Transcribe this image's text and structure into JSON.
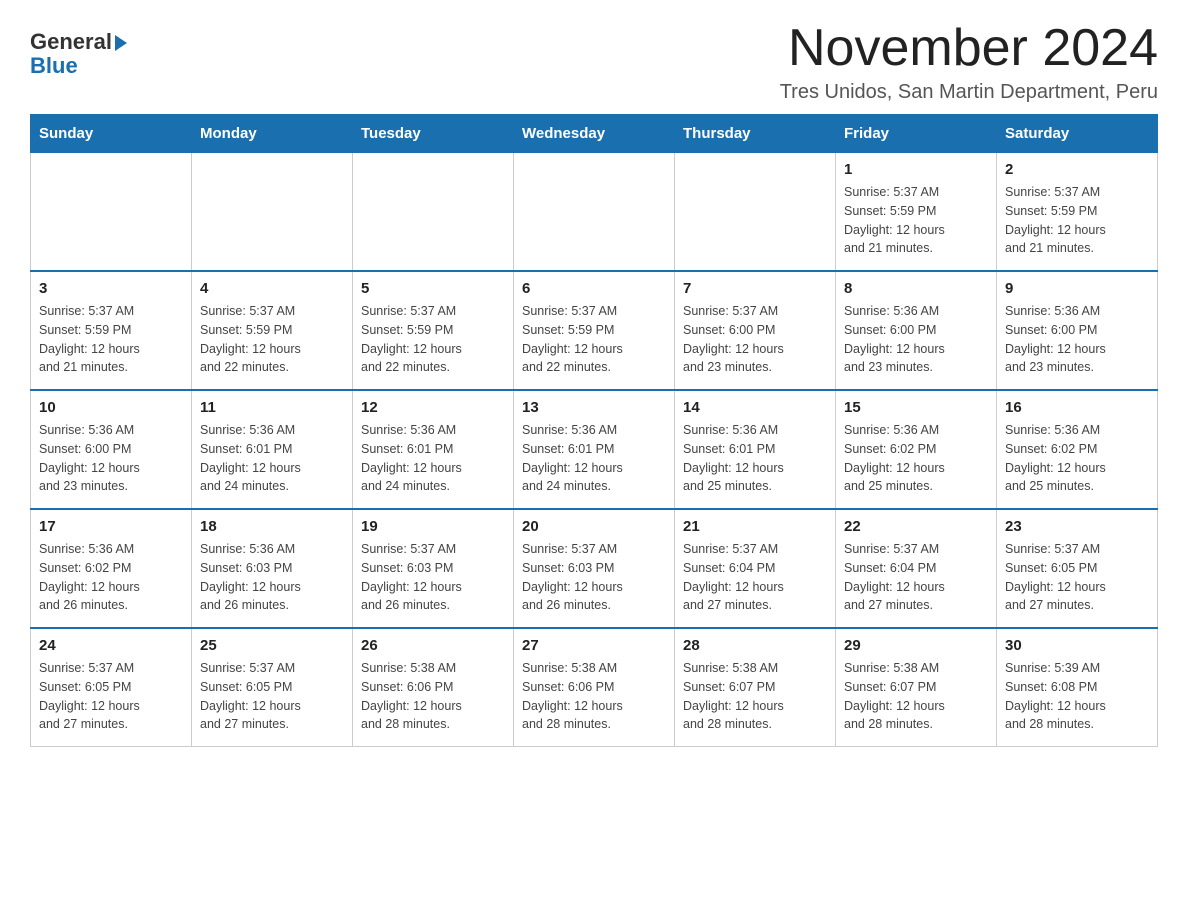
{
  "logo": {
    "part1": "General",
    "part2": "Blue"
  },
  "title": "November 2024",
  "location": "Tres Unidos, San Martin Department, Peru",
  "weekdays": [
    "Sunday",
    "Monday",
    "Tuesday",
    "Wednesday",
    "Thursday",
    "Friday",
    "Saturday"
  ],
  "rows": [
    [
      {
        "day": "",
        "info": ""
      },
      {
        "day": "",
        "info": ""
      },
      {
        "day": "",
        "info": ""
      },
      {
        "day": "",
        "info": ""
      },
      {
        "day": "",
        "info": ""
      },
      {
        "day": "1",
        "info": "Sunrise: 5:37 AM\nSunset: 5:59 PM\nDaylight: 12 hours\nand 21 minutes."
      },
      {
        "day": "2",
        "info": "Sunrise: 5:37 AM\nSunset: 5:59 PM\nDaylight: 12 hours\nand 21 minutes."
      }
    ],
    [
      {
        "day": "3",
        "info": "Sunrise: 5:37 AM\nSunset: 5:59 PM\nDaylight: 12 hours\nand 21 minutes."
      },
      {
        "day": "4",
        "info": "Sunrise: 5:37 AM\nSunset: 5:59 PM\nDaylight: 12 hours\nand 22 minutes."
      },
      {
        "day": "5",
        "info": "Sunrise: 5:37 AM\nSunset: 5:59 PM\nDaylight: 12 hours\nand 22 minutes."
      },
      {
        "day": "6",
        "info": "Sunrise: 5:37 AM\nSunset: 5:59 PM\nDaylight: 12 hours\nand 22 minutes."
      },
      {
        "day": "7",
        "info": "Sunrise: 5:37 AM\nSunset: 6:00 PM\nDaylight: 12 hours\nand 23 minutes."
      },
      {
        "day": "8",
        "info": "Sunrise: 5:36 AM\nSunset: 6:00 PM\nDaylight: 12 hours\nand 23 minutes."
      },
      {
        "day": "9",
        "info": "Sunrise: 5:36 AM\nSunset: 6:00 PM\nDaylight: 12 hours\nand 23 minutes."
      }
    ],
    [
      {
        "day": "10",
        "info": "Sunrise: 5:36 AM\nSunset: 6:00 PM\nDaylight: 12 hours\nand 23 minutes."
      },
      {
        "day": "11",
        "info": "Sunrise: 5:36 AM\nSunset: 6:01 PM\nDaylight: 12 hours\nand 24 minutes."
      },
      {
        "day": "12",
        "info": "Sunrise: 5:36 AM\nSunset: 6:01 PM\nDaylight: 12 hours\nand 24 minutes."
      },
      {
        "day": "13",
        "info": "Sunrise: 5:36 AM\nSunset: 6:01 PM\nDaylight: 12 hours\nand 24 minutes."
      },
      {
        "day": "14",
        "info": "Sunrise: 5:36 AM\nSunset: 6:01 PM\nDaylight: 12 hours\nand 25 minutes."
      },
      {
        "day": "15",
        "info": "Sunrise: 5:36 AM\nSunset: 6:02 PM\nDaylight: 12 hours\nand 25 minutes."
      },
      {
        "day": "16",
        "info": "Sunrise: 5:36 AM\nSunset: 6:02 PM\nDaylight: 12 hours\nand 25 minutes."
      }
    ],
    [
      {
        "day": "17",
        "info": "Sunrise: 5:36 AM\nSunset: 6:02 PM\nDaylight: 12 hours\nand 26 minutes."
      },
      {
        "day": "18",
        "info": "Sunrise: 5:36 AM\nSunset: 6:03 PM\nDaylight: 12 hours\nand 26 minutes."
      },
      {
        "day": "19",
        "info": "Sunrise: 5:37 AM\nSunset: 6:03 PM\nDaylight: 12 hours\nand 26 minutes."
      },
      {
        "day": "20",
        "info": "Sunrise: 5:37 AM\nSunset: 6:03 PM\nDaylight: 12 hours\nand 26 minutes."
      },
      {
        "day": "21",
        "info": "Sunrise: 5:37 AM\nSunset: 6:04 PM\nDaylight: 12 hours\nand 27 minutes."
      },
      {
        "day": "22",
        "info": "Sunrise: 5:37 AM\nSunset: 6:04 PM\nDaylight: 12 hours\nand 27 minutes."
      },
      {
        "day": "23",
        "info": "Sunrise: 5:37 AM\nSunset: 6:05 PM\nDaylight: 12 hours\nand 27 minutes."
      }
    ],
    [
      {
        "day": "24",
        "info": "Sunrise: 5:37 AM\nSunset: 6:05 PM\nDaylight: 12 hours\nand 27 minutes."
      },
      {
        "day": "25",
        "info": "Sunrise: 5:37 AM\nSunset: 6:05 PM\nDaylight: 12 hours\nand 27 minutes."
      },
      {
        "day": "26",
        "info": "Sunrise: 5:38 AM\nSunset: 6:06 PM\nDaylight: 12 hours\nand 28 minutes."
      },
      {
        "day": "27",
        "info": "Sunrise: 5:38 AM\nSunset: 6:06 PM\nDaylight: 12 hours\nand 28 minutes."
      },
      {
        "day": "28",
        "info": "Sunrise: 5:38 AM\nSunset: 6:07 PM\nDaylight: 12 hours\nand 28 minutes."
      },
      {
        "day": "29",
        "info": "Sunrise: 5:38 AM\nSunset: 6:07 PM\nDaylight: 12 hours\nand 28 minutes."
      },
      {
        "day": "30",
        "info": "Sunrise: 5:39 AM\nSunset: 6:08 PM\nDaylight: 12 hours\nand 28 minutes."
      }
    ]
  ]
}
